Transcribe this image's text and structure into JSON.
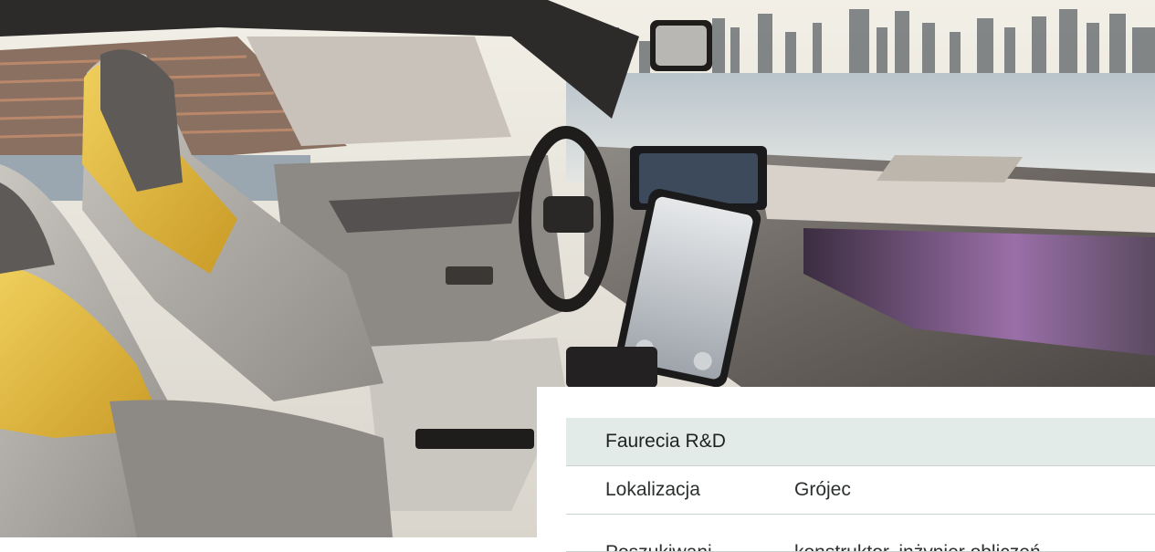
{
  "hero": {
    "alt_subject": "car-interior-photo"
  },
  "info_table": {
    "title": "Faurecia R&D",
    "rows": [
      {
        "label": "Lokalizacja",
        "value": "Grójec"
      },
      {
        "label": "Poszukiwani",
        "value": "konstruktor, inżynier obliczeń"
      }
    ]
  },
  "colors": {
    "table_header_bg": "#e2ebe7",
    "table_border": "#c9d3cf",
    "seat_yellow": "#e2b73c"
  }
}
